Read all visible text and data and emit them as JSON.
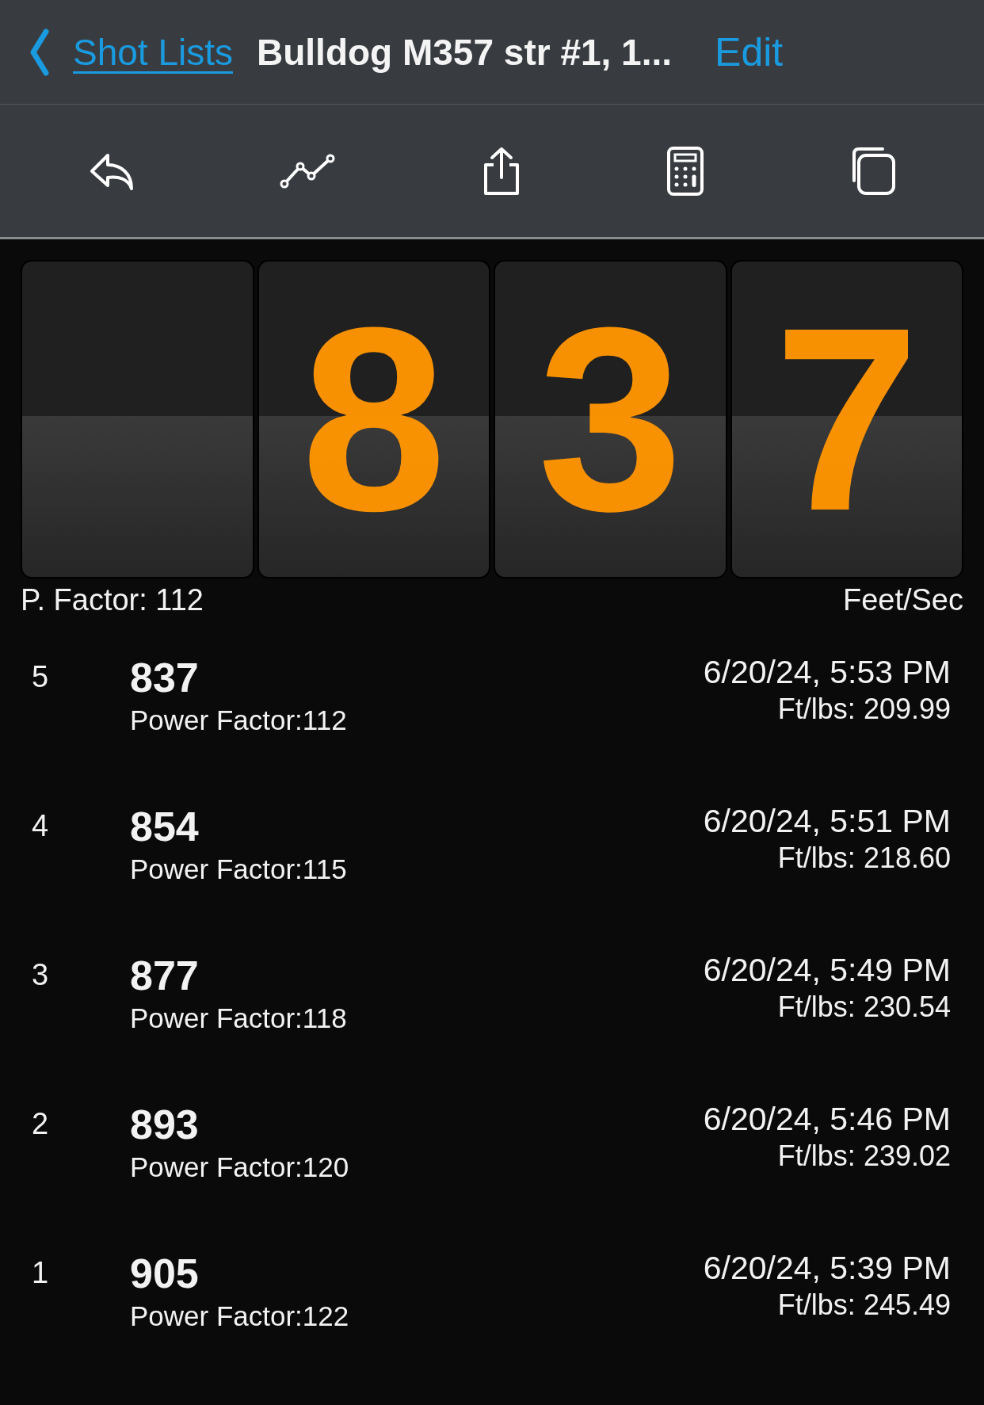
{
  "nav": {
    "back_label": "Shot Lists",
    "title": "Bulldog M357 str #1, 1...",
    "edit": "Edit"
  },
  "display_tiles": [
    {
      "kind": "blank"
    },
    {
      "kind": "digit",
      "digit": "8"
    },
    {
      "kind": "digit",
      "digit": "3"
    },
    {
      "kind": "digit",
      "digit": "7"
    }
  ],
  "display_labels": {
    "left": "P. Factor: 112",
    "right": "Feet/Sec"
  },
  "shots": [
    {
      "number": "5",
      "velocity": "837",
      "power_factor": "Power Factor:112",
      "time": "6/20/24, 5:53 PM",
      "energy": "Ft/lbs: 209.99"
    },
    {
      "number": "4",
      "velocity": "854",
      "power_factor": "Power Factor:115",
      "time": "6/20/24, 5:51 PM",
      "energy": "Ft/lbs: 218.60"
    },
    {
      "number": "3",
      "velocity": "877",
      "power_factor": "Power Factor:118",
      "time": "6/20/24, 5:49 PM",
      "energy": "Ft/lbs: 230.54"
    },
    {
      "number": "2",
      "velocity": "893",
      "power_factor": "Power Factor:120",
      "time": "6/20/24, 5:46 PM",
      "energy": "Ft/lbs: 239.02"
    },
    {
      "number": "1",
      "velocity": "905",
      "power_factor": "Power Factor:122",
      "time": "6/20/24, 5:39 PM",
      "energy": "Ft/lbs: 245.49"
    }
  ]
}
